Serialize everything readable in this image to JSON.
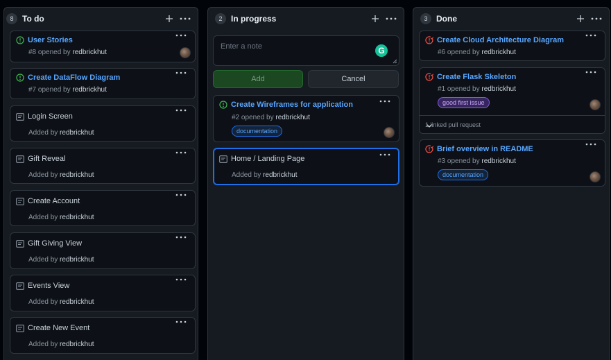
{
  "columns": {
    "todo": {
      "count": "8",
      "title": "To do",
      "cards": [
        {
          "title": "User Stories",
          "meta_prefix": "#8 opened by",
          "user": "redbrickhut"
        },
        {
          "title": "Create DataFlow Diagram",
          "meta_prefix": "#7 opened by",
          "user": "redbrickhut"
        },
        {
          "title": "Login Screen",
          "meta_prefix": "Added by",
          "user": "redbrickhut"
        },
        {
          "title": "Gift Reveal",
          "meta_prefix": "Added by",
          "user": "redbrickhut"
        },
        {
          "title": "Create Account",
          "meta_prefix": "Added by",
          "user": "redbrickhut"
        },
        {
          "title": "Gift Giving View",
          "meta_prefix": "Added by",
          "user": "redbrickhut"
        },
        {
          "title": "Events View",
          "meta_prefix": "Added by",
          "user": "redbrickhut"
        },
        {
          "title": "Create New Event",
          "meta_prefix": "Added by",
          "user": "redbrickhut"
        }
      ]
    },
    "inprogress": {
      "count": "2",
      "title": "In progress",
      "note_placeholder": "Enter a note",
      "add_label": "Add",
      "cancel_label": "Cancel",
      "cards": [
        {
          "title": "Create Wireframes for application",
          "meta_prefix": "#2 opened by",
          "user": "redbrickhut",
          "label": "documentation"
        },
        {
          "title": "Home / Landing Page",
          "meta_prefix": "Added by",
          "user": "redbrickhut"
        }
      ]
    },
    "done": {
      "count": "3",
      "title": "Done",
      "cards": [
        {
          "title": "Create Cloud Architecture Diagram",
          "meta_prefix": "#6 opened by",
          "user": "redbrickhut"
        },
        {
          "title": "Create Flask Skeleton",
          "meta_prefix": "#1 opened by",
          "user": "redbrickhut",
          "label": "good first issue",
          "linked": "1 linked pull request"
        },
        {
          "title": "Brief overview in README",
          "meta_prefix": "#3 opened by",
          "user": "redbrickhut",
          "label": "documentation"
        }
      ]
    }
  },
  "colors": {
    "open_issue": "#3fb950",
    "closed_issue": "#f85149",
    "link": "#58a6ff",
    "background": "#010409",
    "column": "#161b22"
  }
}
